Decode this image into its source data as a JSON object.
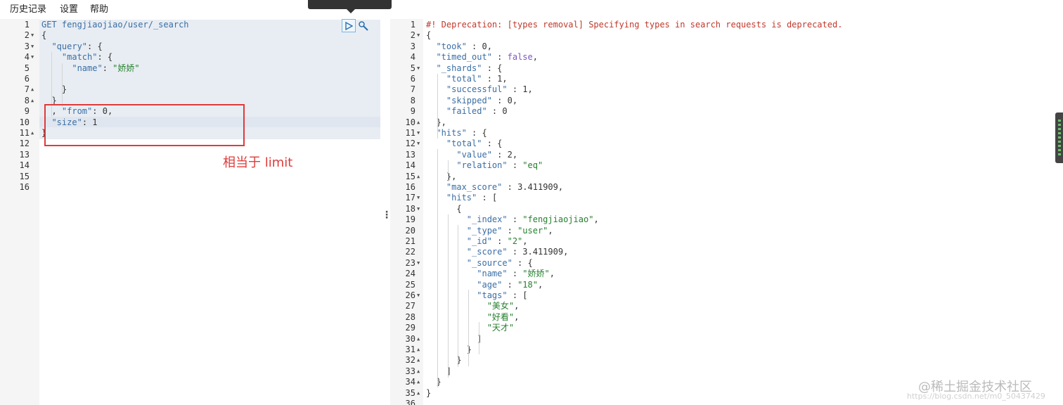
{
  "menu": {
    "history": "历史记录",
    "settings": "设置",
    "help": "帮助"
  },
  "request": {
    "lines": [
      [
        [
          "k",
          "GET "
        ],
        [
          "u",
          "fengjiaojiao/user/_search"
        ]
      ],
      [
        [
          "p",
          "{"
        ]
      ],
      [
        [
          "p",
          "  "
        ],
        [
          "k",
          "\"query\""
        ],
        [
          "p",
          ": {"
        ]
      ],
      [
        [
          "p",
          "    "
        ],
        [
          "k",
          "\"match\""
        ],
        [
          "p",
          ": {"
        ]
      ],
      [
        [
          "p",
          "      "
        ],
        [
          "k",
          "\"name\""
        ],
        [
          "p",
          ": "
        ],
        [
          "s",
          "\"娇娇\""
        ]
      ],
      [],
      [
        [
          "p",
          "    }"
        ]
      ],
      [
        [
          "p",
          "  }"
        ]
      ],
      [
        [
          "p",
          "  , "
        ],
        [
          "k",
          "\"from\""
        ],
        [
          "p",
          ": "
        ],
        [
          "n",
          "0"
        ],
        [
          "p",
          ","
        ]
      ],
      [
        [
          "p",
          "  "
        ],
        [
          "k",
          "\"size\""
        ],
        [
          "p",
          ": "
        ],
        [
          "n",
          "1"
        ]
      ],
      [
        [
          "p",
          "}"
        ]
      ],
      [],
      [],
      [],
      [],
      []
    ],
    "folds": [
      2,
      3,
      4,
      7,
      8,
      11
    ]
  },
  "response": {
    "lines": [
      [
        [
          "c",
          "#! Deprecation: [types removal] Specifying types in search requests is deprecated."
        ]
      ],
      [
        [
          "p",
          "{"
        ]
      ],
      [
        [
          "p",
          "  "
        ],
        [
          "k",
          "\"took\""
        ],
        [
          "p",
          " : "
        ],
        [
          "n",
          "0"
        ],
        [
          "p",
          ","
        ]
      ],
      [
        [
          "p",
          "  "
        ],
        [
          "k",
          "\"timed_out\""
        ],
        [
          "p",
          " : "
        ],
        [
          "b",
          "false"
        ],
        [
          "p",
          ","
        ]
      ],
      [
        [
          "p",
          "  "
        ],
        [
          "k",
          "\"_shards\""
        ],
        [
          "p",
          " : {"
        ]
      ],
      [
        [
          "p",
          "    "
        ],
        [
          "k",
          "\"total\""
        ],
        [
          "p",
          " : "
        ],
        [
          "n",
          "1"
        ],
        [
          "p",
          ","
        ]
      ],
      [
        [
          "p",
          "    "
        ],
        [
          "k",
          "\"successful\""
        ],
        [
          "p",
          " : "
        ],
        [
          "n",
          "1"
        ],
        [
          "p",
          ","
        ]
      ],
      [
        [
          "p",
          "    "
        ],
        [
          "k",
          "\"skipped\""
        ],
        [
          "p",
          " : "
        ],
        [
          "n",
          "0"
        ],
        [
          "p",
          ","
        ]
      ],
      [
        [
          "p",
          "    "
        ],
        [
          "k",
          "\"failed\""
        ],
        [
          "p",
          " : "
        ],
        [
          "n",
          "0"
        ]
      ],
      [
        [
          "p",
          "  },"
        ]
      ],
      [
        [
          "p",
          "  "
        ],
        [
          "k",
          "\"hits\""
        ],
        [
          "p",
          " : {"
        ]
      ],
      [
        [
          "p",
          "    "
        ],
        [
          "k",
          "\"total\""
        ],
        [
          "p",
          " : {"
        ]
      ],
      [
        [
          "p",
          "      "
        ],
        [
          "k",
          "\"value\""
        ],
        [
          "p",
          " : "
        ],
        [
          "n",
          "2"
        ],
        [
          "p",
          ","
        ]
      ],
      [
        [
          "p",
          "      "
        ],
        [
          "k",
          "\"relation\""
        ],
        [
          "p",
          " : "
        ],
        [
          "s",
          "\"eq\""
        ]
      ],
      [
        [
          "p",
          "    },"
        ]
      ],
      [
        [
          "p",
          "    "
        ],
        [
          "k",
          "\"max_score\""
        ],
        [
          "p",
          " : "
        ],
        [
          "n",
          "3.411909"
        ],
        [
          "p",
          ","
        ]
      ],
      [
        [
          "p",
          "    "
        ],
        [
          "k",
          "\"hits\""
        ],
        [
          "p",
          " : ["
        ]
      ],
      [
        [
          "p",
          "      {"
        ]
      ],
      [
        [
          "p",
          "        "
        ],
        [
          "k",
          "\"_index\""
        ],
        [
          "p",
          " : "
        ],
        [
          "s",
          "\"fengjiaojiao\""
        ],
        [
          "p",
          ","
        ]
      ],
      [
        [
          "p",
          "        "
        ],
        [
          "k",
          "\"_type\""
        ],
        [
          "p",
          " : "
        ],
        [
          "s",
          "\"user\""
        ],
        [
          "p",
          ","
        ]
      ],
      [
        [
          "p",
          "        "
        ],
        [
          "k",
          "\"_id\""
        ],
        [
          "p",
          " : "
        ],
        [
          "s",
          "\"2\""
        ],
        [
          "p",
          ","
        ]
      ],
      [
        [
          "p",
          "        "
        ],
        [
          "k",
          "\"_score\""
        ],
        [
          "p",
          " : "
        ],
        [
          "n",
          "3.411909"
        ],
        [
          "p",
          ","
        ]
      ],
      [
        [
          "p",
          "        "
        ],
        [
          "k",
          "\"_source\""
        ],
        [
          "p",
          " : {"
        ]
      ],
      [
        [
          "p",
          "          "
        ],
        [
          "k",
          "\"name\""
        ],
        [
          "p",
          " : "
        ],
        [
          "s",
          "\"娇娇\""
        ],
        [
          "p",
          ","
        ]
      ],
      [
        [
          "p",
          "          "
        ],
        [
          "k",
          "\"age\""
        ],
        [
          "p",
          " : "
        ],
        [
          "s",
          "\"18\""
        ],
        [
          "p",
          ","
        ]
      ],
      [
        [
          "p",
          "          "
        ],
        [
          "k",
          "\"tags\""
        ],
        [
          "p",
          " : ["
        ]
      ],
      [
        [
          "p",
          "            "
        ],
        [
          "s",
          "\"美女\""
        ],
        [
          "p",
          ","
        ]
      ],
      [
        [
          "p",
          "            "
        ],
        [
          "s",
          "\"好看\""
        ],
        [
          "p",
          ","
        ]
      ],
      [
        [
          "p",
          "            "
        ],
        [
          "s",
          "\"天才\""
        ]
      ],
      [
        [
          "p",
          "          ]"
        ]
      ],
      [
        [
          "p",
          "        }"
        ]
      ],
      [
        [
          "p",
          "      }"
        ]
      ],
      [
        [
          "p",
          "    ]"
        ]
      ],
      [
        [
          "p",
          "  }"
        ]
      ],
      [
        [
          "p",
          "}"
        ]
      ],
      []
    ],
    "folds": [
      2,
      5,
      10,
      11,
      12,
      15,
      17,
      18,
      23,
      26,
      30,
      31,
      32,
      33,
      34,
      35
    ]
  },
  "annotation": "相当于 limit",
  "watermark": {
    "main": "@稀土掘金技术社区",
    "sub": "https://blog.csdn.net/m0_50437429"
  },
  "icons": {
    "run": "play-icon",
    "settings": "wrench-icon"
  },
  "colors": {
    "annotation": "#e03a3a",
    "key": "#3a6ea5",
    "string": "#26802e",
    "comment": "#c0392b"
  }
}
